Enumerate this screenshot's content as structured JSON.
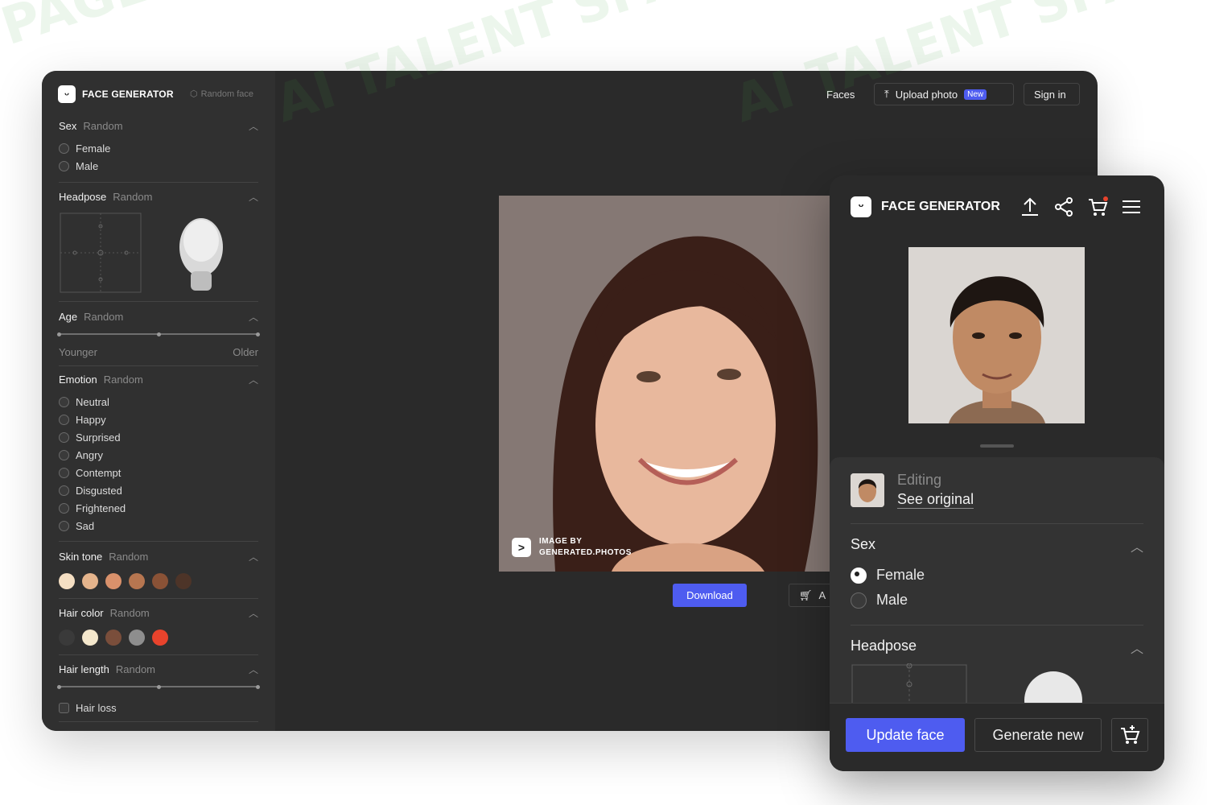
{
  "watermark": {
    "text": "AI TALENT SPACE",
    "corner_text": "PAGE"
  },
  "sidebar": {
    "logo_icon": "face-logo-icon",
    "logo_text": "FACE GENERATOR",
    "random_face": "Random face",
    "sex": {
      "title": "Sex",
      "sub": "Random",
      "options": [
        "Female",
        "Male"
      ]
    },
    "headpose": {
      "title": "Headpose",
      "sub": "Random"
    },
    "age": {
      "title": "Age",
      "sub": "Random",
      "min_label": "Younger",
      "max_label": "Older"
    },
    "emotion": {
      "title": "Emotion",
      "sub": "Random",
      "options": [
        "Neutral",
        "Happy",
        "Surprised",
        "Angry",
        "Contempt",
        "Disgusted",
        "Frightened",
        "Sad"
      ]
    },
    "skin_tone": {
      "title": "Skin tone",
      "sub": "Random",
      "colors": [
        "#f5dfc3",
        "#e5b48c",
        "#d9916b",
        "#b77650",
        "#8a5236",
        "#4d3428"
      ]
    },
    "hair_color": {
      "title": "Hair color",
      "sub": "Random",
      "colors": [
        "#3a3a3a",
        "#f4e7cc",
        "#7a4e3b",
        "#8e8e8e",
        "#e8432c"
      ]
    },
    "hair_length": {
      "title": "Hair length",
      "sub": "Random",
      "hair_loss": "Hair loss"
    }
  },
  "nav": {
    "faces": "Faces",
    "upload_photo": "Upload photo",
    "new_badge": "New",
    "sign_in": "Sign in"
  },
  "main": {
    "credit_line1": "IMAGE BY",
    "credit_line2": "GENERATED.PHOTOS",
    "download": "Download",
    "cart_partial": "A"
  },
  "mobile": {
    "logo_text": "FACE GENERATOR",
    "editing": "Editing",
    "see_original": "See original",
    "sex_title": "Sex",
    "sex_options": [
      "Female",
      "Male"
    ],
    "sex_selected": "Female",
    "headpose_title": "Headpose",
    "update_face": "Update face",
    "generate_new": "Generate new"
  },
  "colors": {
    "accent": "#4e5cf0",
    "panel": "#2a2a2a",
    "sidebar": "#303030"
  }
}
